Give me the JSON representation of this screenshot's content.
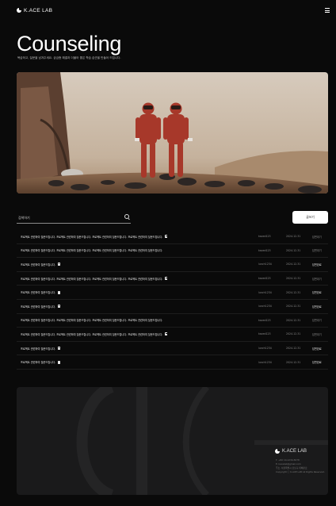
{
  "header": {
    "brand": "K.ACE LAB"
  },
  "page": {
    "title": "Counseling",
    "subtitle": "복습하고, 질문을 남겨주세요. 궁금증 해결과 더불어 좋은 학습 습관을 만들어 드립니다."
  },
  "search": {
    "placeholder": "검색하기"
  },
  "actions": {
    "write_label": "글쓰기"
  },
  "posts": [
    {
      "title": "프로젝트 관련하여 질문드립니다. 프로젝트 관련하여 질문드립니다. 프로젝트 관련하여 질문드립니다. 프로젝트 관련하여 질문드립니다.",
      "locked": true,
      "author": "kaced123",
      "date": "2024.12.31",
      "status": "답변대기",
      "answered": false
    },
    {
      "title": "프로젝트 관련하여 질문드립니다. 프로젝트 관련하여 질문드립니다. 프로젝트 관련하여 질문드립니다. 프로젝트 관련하여 질문드립니다.",
      "locked": false,
      "author": "kaced123",
      "date": "2024.12.31",
      "status": "답변대기",
      "answered": false
    },
    {
      "title": "프로젝트 관련하여 질문드립니다.",
      "locked": true,
      "author": "lunch1234",
      "date": "2024.12.31",
      "status": "답변완료",
      "answered": true
    },
    {
      "title": "프로젝트 관련하여 질문드립니다. 프로젝트 관련하여 질문드립니다. 프로젝트 관련하여 질문드립니다. 프로젝트 관련하여 질문드립니다.",
      "locked": true,
      "author": "kaced123",
      "date": "2024.12.31",
      "status": "답변대기",
      "answered": false
    },
    {
      "title": "프로젝트 관련하여 질문드립니다.",
      "locked": true,
      "author": "lunch1234",
      "date": "2024.12.31",
      "status": "답변완료",
      "answered": true
    },
    {
      "title": "프로젝트 관련하여 질문드립니다.",
      "locked": true,
      "author": "lunch1234",
      "date": "2024.12.31",
      "status": "답변완료",
      "answered": true
    },
    {
      "title": "프로젝트 관련하여 질문드립니다. 프로젝트 관련하여 질문드립니다. 프로젝트 관련하여 질문드립니다. 프로젝트 관련하여 질문드립니다.",
      "locked": false,
      "author": "kaced123",
      "date": "2024.12.31",
      "status": "답변대기",
      "answered": false
    },
    {
      "title": "프로젝트 관련하여 질문드립니다. 프로젝트 관련하여 질문드립니다. 프로젝트 관련하여 질문드립니다. 프로젝트 관련하여 질문드립니다.",
      "locked": true,
      "author": "kaced123",
      "date": "2024.12.31",
      "status": "답변대기",
      "answered": false
    },
    {
      "title": "프로젝트 관련하여 질문드립니다.",
      "locked": true,
      "author": "lunch1234",
      "date": "2024.12.31",
      "status": "답변완료",
      "answered": true
    },
    {
      "title": "프로젝트 관련하여 질문드립니다.",
      "locked": true,
      "author": "lunch1234",
      "date": "2024.12.31",
      "status": "답변완료",
      "answered": true
    }
  ],
  "footer": {
    "brand": "K.ACE LAB",
    "info": [
      "T. +82 10-1234-5678",
      "E. kacelab@gmail.com",
      "주소. 서울특별시 강남구 테헤란로",
      "Copyright ⓒ K.ACE LAB All Rights Reserved."
    ]
  },
  "colors": {
    "background": "#0a0a0a",
    "footer_bg": "#1a1a1b",
    "button_bg": "#ffffff"
  }
}
